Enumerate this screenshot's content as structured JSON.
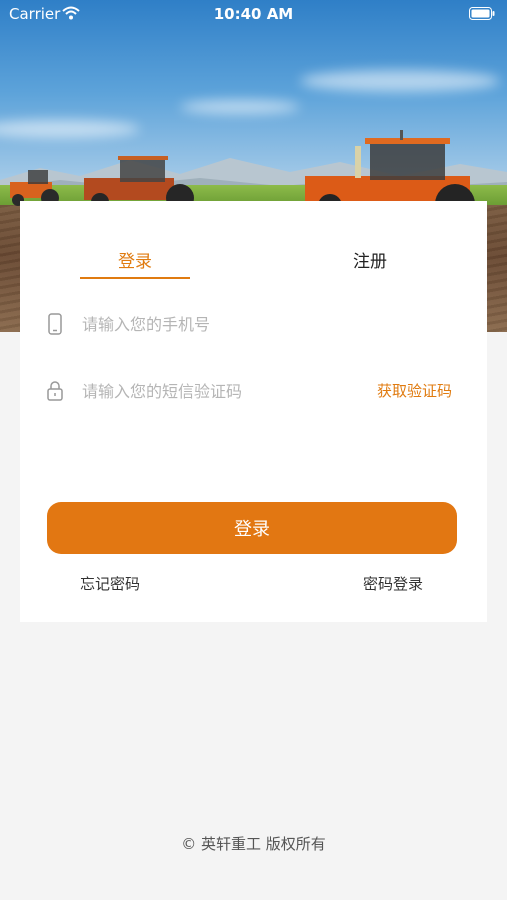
{
  "status_bar": {
    "carrier": "Carrier",
    "time": "10:40 AM"
  },
  "tabs": {
    "login": "登录",
    "register": "注册",
    "active": "login"
  },
  "form": {
    "phone_placeholder": "请输入您的手机号",
    "code_placeholder": "请输入您的短信验证码",
    "get_code_label": "获取验证码",
    "submit_label": "登录",
    "forgot_label": "忘记密码",
    "password_login_label": "密码登录"
  },
  "footer": {
    "copyright": "© 英轩重工  版权所有"
  },
  "colors": {
    "accent": "#e27712",
    "background": "#f4f4f4",
    "placeholder": "#b5b5b5"
  },
  "icons": {
    "phone_field": "phone-icon",
    "code_field": "lock-icon",
    "wifi": "wifi-icon",
    "battery": "battery-icon"
  }
}
